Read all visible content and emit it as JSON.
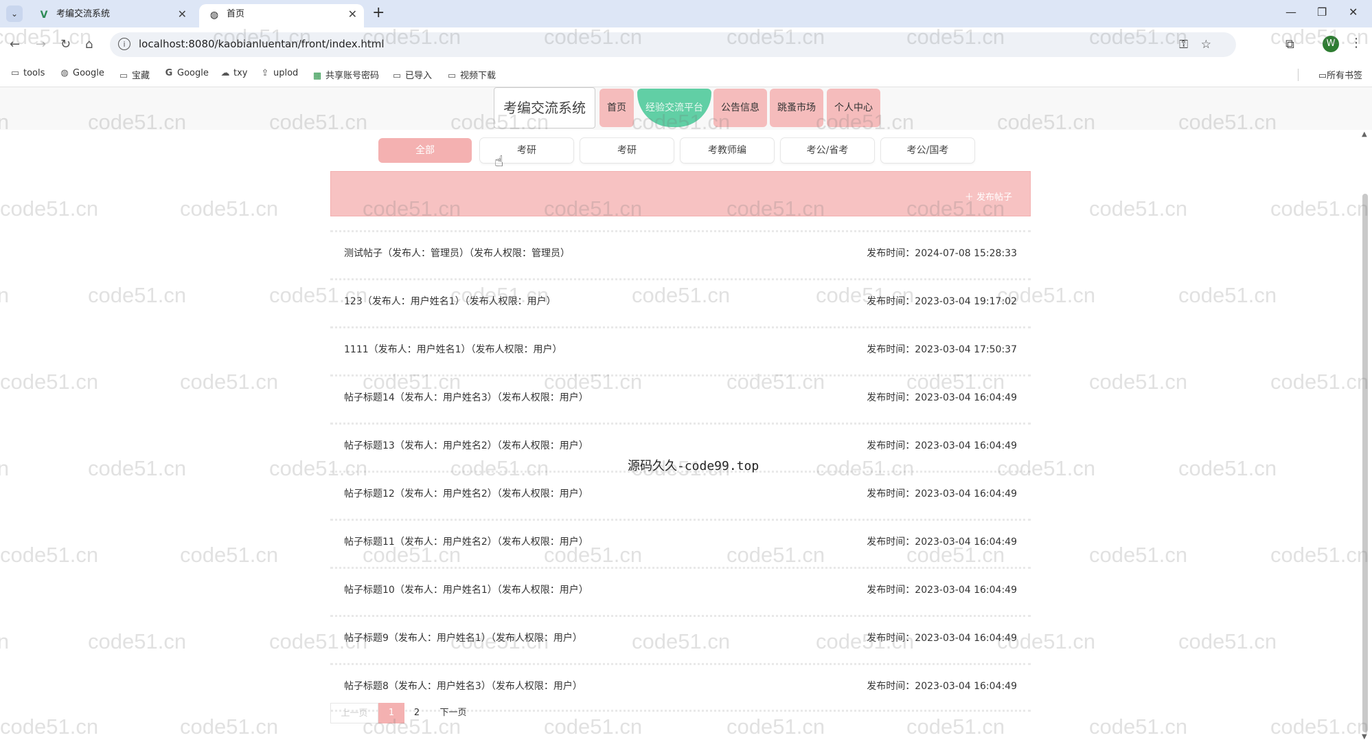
{
  "browser": {
    "tabs": [
      {
        "title": "考编交流系统",
        "favicon": "vue-icon"
      },
      {
        "title": "首页",
        "favicon": "globe-icon"
      }
    ],
    "url": "localhost:8080/kaobianluentan/front/index.html",
    "bookmarks": [
      "tools",
      "Google",
      "宝藏",
      "Google",
      "txy",
      "uplod",
      "共享账号密码",
      "已导入",
      "视频下载"
    ],
    "bookmarks_right": "所有书签",
    "avatar_letter": "W"
  },
  "site": {
    "brand": "考编交流系统",
    "nav": [
      "首页",
      "经验交流平台",
      "公告信息",
      "跳蚤市场",
      "个人中心"
    ],
    "categories": [
      "全部",
      "考研",
      "考研",
      "考教师编",
      "考公/省考",
      "考公/国考"
    ],
    "publish_button": "＋ 发布帖子",
    "posts": [
      {
        "title": "测试帖子（发布人：管理员）（发布人权限：管理员）",
        "time": "发布时间：2024-07-08 15:28:33"
      },
      {
        "title": "123（发布人：用户姓名1）（发布人权限：用户）",
        "time": "发布时间：2023-03-04 19:17:02"
      },
      {
        "title": "1111（发布人：用户姓名1）（发布人权限：用户）",
        "time": "发布时间：2023-03-04 17:50:37"
      },
      {
        "title": "帖子标题14（发布人：用户姓名3）（发布人权限：用户）",
        "time": "发布时间：2023-03-04 16:04:49"
      },
      {
        "title": "帖子标题13（发布人：用户姓名2）（发布人权限：用户）",
        "time": "发布时间：2023-03-04 16:04:49"
      },
      {
        "title": "帖子标题12（发布人：用户姓名2）（发布人权限：用户）",
        "time": "发布时间：2023-03-04 16:04:49"
      },
      {
        "title": "帖子标题11（发布人：用户姓名2）（发布人权限：用户）",
        "time": "发布时间：2023-03-04 16:04:49"
      },
      {
        "title": "帖子标题10（发布人：用户姓名1）（发布人权限：用户）",
        "time": "发布时间：2023-03-04 16:04:49"
      },
      {
        "title": "帖子标题9（发布人：用户姓名1）（发布人权限：用户）",
        "time": "发布时间：2023-03-04 16:04:49"
      },
      {
        "title": "帖子标题8（发布人：用户姓名3）（发布人权限：用户）",
        "time": "发布时间：2023-03-04 16:04:49"
      }
    ],
    "pager": {
      "prev": "上一页",
      "pages": [
        "1",
        "2"
      ],
      "next": "下一页"
    },
    "overlay_text": "源码久久-code99.top",
    "watermark": "code51.cn"
  },
  "colors": {
    "pink": "#f5bcbc",
    "green": "#61cfa5",
    "active_pink": "#f4b1b1"
  }
}
